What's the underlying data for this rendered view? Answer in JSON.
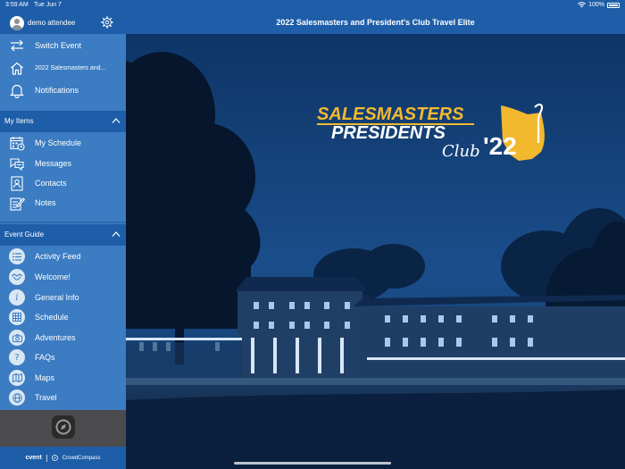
{
  "status_bar": {
    "time": "3:59 AM",
    "date": "Tue Jun 7",
    "battery": "100%"
  },
  "user": {
    "name": "demo attendee"
  },
  "header": {
    "title": "2022 Salesmasters and President's Club Travel Elite"
  },
  "top_nav": [
    {
      "label": "Switch Event",
      "icon": "switch-arrows-icon"
    },
    {
      "label": "2022 Salesmasters and...",
      "icon": "home-icon"
    },
    {
      "label": "Notifications",
      "icon": "bell-icon"
    }
  ],
  "my_items": {
    "title": "My Items",
    "items": [
      {
        "label": "My Schedule",
        "icon": "calendar-icon"
      },
      {
        "label": "Messages",
        "icon": "chat-icon"
      },
      {
        "label": "Contacts",
        "icon": "contact-card-icon"
      },
      {
        "label": "Notes",
        "icon": "note-pencil-icon"
      }
    ]
  },
  "event_guide": {
    "title": "Event Guide",
    "items": [
      {
        "label": "Activity Feed",
        "icon": "list-icon"
      },
      {
        "label": "Welcome!",
        "icon": "handshake-icon"
      },
      {
        "label": "General Info",
        "icon": "info-icon"
      },
      {
        "label": "Schedule",
        "icon": "grid-icon"
      },
      {
        "label": "Adventures",
        "icon": "camera-icon"
      },
      {
        "label": "FAQs",
        "icon": "question-icon"
      },
      {
        "label": "Maps",
        "icon": "map-icon"
      },
      {
        "label": "Travel",
        "icon": "globe-icon"
      }
    ]
  },
  "footer": {
    "brand_left": "cvent",
    "brand_right": "CrowdCompass"
  },
  "logo": {
    "line1": "SALESMASTERS",
    "line2": "PRESIDENTS",
    "script": "Club",
    "year": "'22"
  },
  "colors": {
    "sidebar": "#3b7cc2",
    "header": "#1e5ea8",
    "logo_gold": "#f2b92e"
  }
}
